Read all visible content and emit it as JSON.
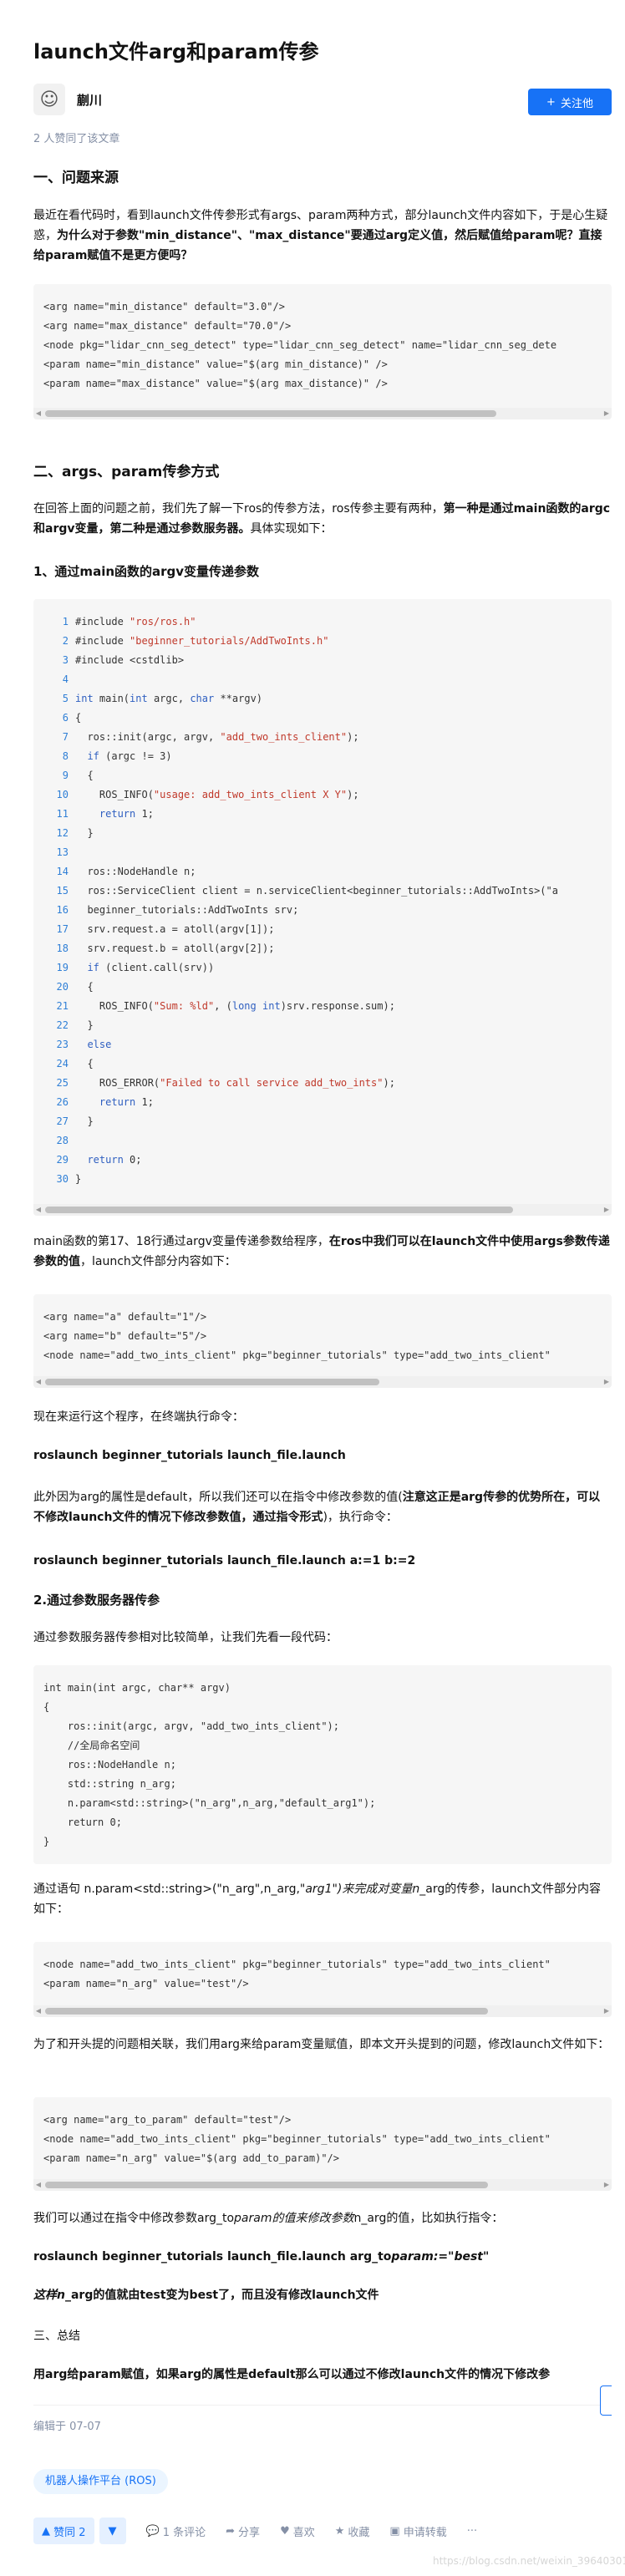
{
  "article": {
    "title": "launch文件arg和param传参",
    "author": "蒯川",
    "follow_label": "关注他",
    "likes_note": "2 人赞同了该文章"
  },
  "sections": {
    "s1_title": "一、问题来源",
    "s1_p1_a": "最近在看代码时，看到launch文件传参形式有args、param两种方式，部分launch文件内容如下，于是心生疑惑，",
    "s1_p1_b": "为什么对于参数\"min_distance\"、\"max_distance\"要通过arg定义值，然后赋值给param呢？直接给param赋值不是更方便吗？",
    "code1": [
      "<arg name=\"min_distance\" default=\"3.0\"/>",
      "<arg name=\"max_distance\" default=\"70.0\"/>",
      "<node pkg=\"lidar_cnn_seg_detect\" type=\"lidar_cnn_seg_detect\" name=\"lidar_cnn_seg_dete",
      "<param name=\"min_distance\" value=\"$(arg min_distance)\" />",
      "<param name=\"max_distance\" value=\"$(arg max_distance)\" />"
    ],
    "s2_title": "二、args、param传参方式",
    "s2_p1_a": "在回答上面的问题之前，我们先了解一下ros的传参方法，ros传参主要有两种，",
    "s2_p1_b": "第一种是通过main函数的argc和argv变量，第二种是通过参数服务器。",
    "s2_p1_c": "具体实现如下：",
    "s2_h1": "1、通过main函数的argv变量传递参数",
    "code2": [
      "#include \"ros/ros.h\"",
      "#include \"beginner_tutorials/AddTwoInts.h\"",
      "#include <cstdlib>",
      "",
      "int main(int argc, char **argv)",
      "{",
      "  ros::init(argc, argv, \"add_two_ints_client\");",
      "  if (argc != 3)",
      "  {",
      "    ROS_INFO(\"usage: add_two_ints_client X Y\");",
      "    return 1;",
      "  }",
      "",
      "  ros::NodeHandle n;",
      "  ros::ServiceClient client = n.serviceClient<beginner_tutorials::AddTwoInts>(\"a",
      "  beginner_tutorials::AddTwoInts srv;",
      "  srv.request.a = atoll(argv[1]);",
      "  srv.request.b = atoll(argv[2]);",
      "  if (client.call(srv))",
      "  {",
      "    ROS_INFO(\"Sum: %ld\", (long int)srv.response.sum);",
      "  }",
      "  else",
      "  {",
      "    ROS_ERROR(\"Failed to call service add_two_ints\");",
      "    return 1;",
      "  }",
      "",
      "  return 0;",
      "}"
    ],
    "s2_p2_a": "main函数的第17、18行通过argv变量传递参数给程序，",
    "s2_p2_b": "在ros中我们可以在launch文件中使用args参数传递参数的值",
    "s2_p2_c": "，launch文件部分内容如下：",
    "code3": [
      "<arg name=\"a\" default=\"1\"/>",
      "<arg name=\"b\" default=\"5\"/>",
      "<node name=\"add_two_ints_client\" pkg=\"beginner_tutorials\" type=\"add_two_ints_client\""
    ],
    "s2_p3": "现在来运行这个程序，在终端执行命令：",
    "s2_cmd1": "roslaunch beginner_tutorials launch_file.launch",
    "s2_p4_a": "此外因为arg的属性是default，所以我们还可以在指令中修改参数的值(",
    "s2_p4_b": "注意这正是arg传参的优势所在，可以不修改launch文件的情况下修改参数值，通过指令形式",
    "s2_p4_c": ")，执行命令：",
    "s2_cmd2": "roslaunch beginner_tutorials launch_file.launch a:=1 b:=2",
    "s2_h2": "2.通过参数服务器传参",
    "s2_p5": "通过参数服务器传参相对比较简单，让我们先看一段代码：",
    "code4": [
      "int main(int argc, char** argv)",
      "{",
      "    ros::init(argc, argv, \"add_two_ints_client\");",
      "    //全局命名空间",
      "    ros::NodeHandle n;",
      "    std::string n_arg;",
      "    n.param<std::string>(\"n_arg\",n_arg,\"default_arg1\");",
      "    return 0;",
      "}"
    ],
    "s2_p6_a": "通过语句 n.param<std::string>(\"n_arg\",n_arg,\"",
    "s2_p6_b": "arg1\")来完成对变量n",
    "s2_p6_c": "_arg的传参，launch文件部分内容如下：",
    "code5": [
      "<node name=\"add_two_ints_client\" pkg=\"beginner_tutorials\" type=\"add_two_ints_client\"",
      "<param name=\"n_arg\" value=\"test\"/>"
    ],
    "s2_p7": "为了和开头提的问题相关联，我们用arg来给param变量赋值，即本文开头提到的问题，修改launch文件如下：",
    "code6": [
      "<arg name=\"arg_to_param\" default=\"test\"/>",
      "<node name=\"add_two_ints_client\" pkg=\"beginner_tutorials\" type=\"add_two_ints_client\"",
      "<param name=\"n_arg\" value=\"$(arg add_to_param)\"/>"
    ],
    "s2_p8_a": "我们可以通过在指令中修改参数arg_to",
    "s2_p8_b": "param的值来修改参数",
    "s2_p8_c": "n_arg的值，比如执行指令：",
    "s2_cmd3_a": "roslaunch beginner_tutorials launch_file.launch arg_to",
    "s2_cmd3_b": "param:=\"best\"",
    "s2_p9_a": "这样n",
    "s2_p9_b": "_arg的值就由test变为best了，而且没有修改launch文件",
    "s3_title": "三、总结",
    "s3_p1": "用arg给param赋值，如果arg的属性是default那么可以通过不修改launch文件的情况下修改参"
  },
  "footer": {
    "date": "编辑于 07-07",
    "tag": "机器人操作平台 (ROS)",
    "vote_label": "赞同 2",
    "comment_label": "1 条评论",
    "share_label": "分享",
    "like_label": "喜欢",
    "fav_label": "收藏",
    "report_label": "申请转载",
    "more_label": "···",
    "watermark": "https://blog.csdn.net/weixin_39640301"
  },
  "colors": {
    "accent": "#1772f6",
    "code_bg": "#f6f6f6"
  }
}
